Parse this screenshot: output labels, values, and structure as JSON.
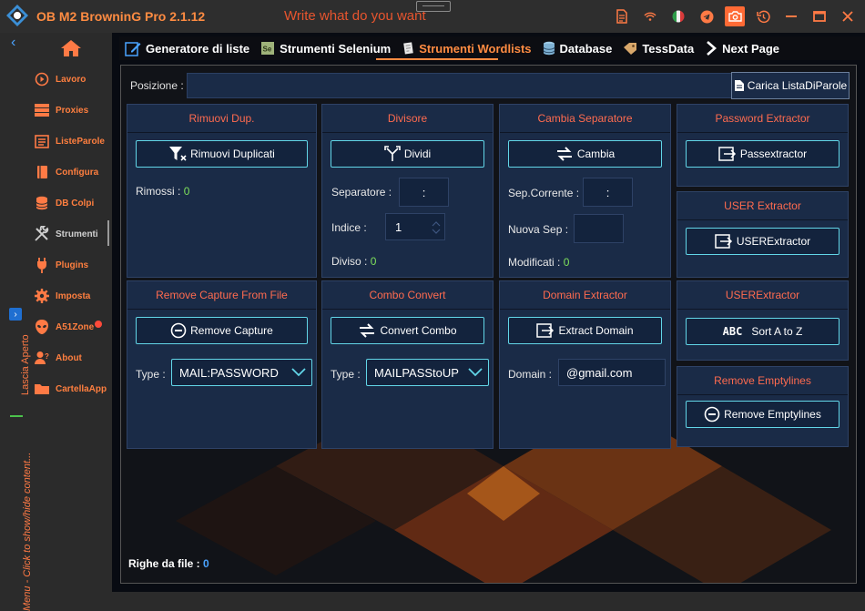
{
  "titlebar": {
    "title": "OB M2 BrowninG Pro  2.1.12",
    "tagline": "Write what do you want",
    "icons": [
      "document-icon",
      "wifi-icon",
      "italy-flag-icon",
      "telegram-icon",
      "camera-icon",
      "history-icon",
      "minimize-icon",
      "maximize-icon",
      "close-icon"
    ]
  },
  "sidebar": {
    "items": [
      {
        "label": "Lavoro",
        "icon": "play-icon"
      },
      {
        "label": "Proxies",
        "icon": "server-icon"
      },
      {
        "label": "ListeParole",
        "icon": "list-icon"
      },
      {
        "label": "Configura",
        "icon": "book-icon"
      },
      {
        "label": "DB Colpi",
        "icon": "database-icon"
      },
      {
        "label": "Strumenti",
        "icon": "tools-icon"
      },
      {
        "label": "Plugins",
        "icon": "plug-icon"
      },
      {
        "label": "Imposta",
        "icon": "gear-icon"
      },
      {
        "label": "A51Zone",
        "icon": "alien-icon"
      },
      {
        "label": "About",
        "icon": "user-question-icon"
      },
      {
        "label": "CartellaApp",
        "icon": "folder-icon"
      }
    ],
    "vertical_open": "Lascia Aperto",
    "vertical_menu": "Menu - Click to show/hide content..."
  },
  "tabs": [
    {
      "label": "Generatore di liste",
      "icon": "edit-icon"
    },
    {
      "label": "Strumenti Selenium",
      "icon": "selenium-icon"
    },
    {
      "label": "Strumenti Wordlists",
      "icon": "scroll-icon"
    },
    {
      "label": "Database",
      "icon": "database-icon"
    },
    {
      "label": "TessData",
      "icon": "tag-icon"
    },
    {
      "label": "Next Page",
      "icon": "chevron-right-icon"
    }
  ],
  "posizione": {
    "label": "Posizione :",
    "value": "",
    "button": "Carica ListaDiParole"
  },
  "rimuovi": {
    "title": "Rimuovi Dup.",
    "button": "Rimuovi Duplicati",
    "rimossi_label": "Rimossi :",
    "rimossi_value": "0"
  },
  "divisore": {
    "title": "Divisore",
    "button": "Dividi",
    "separatore_label": "Separatore :",
    "separatore_value": ":",
    "indice_label": "Indice :",
    "indice_value": "1",
    "diviso_label": "Diviso :",
    "diviso_value": "0"
  },
  "cambia": {
    "title": "Cambia Separatore",
    "button": "Cambia",
    "sep_label": "Sep.Corrente :",
    "sep_value": ":",
    "nuova_label": "Nuova Sep :",
    "nuova_value": "",
    "mod_label": "Modificati :",
    "mod_value": "0"
  },
  "password_extractor": {
    "title": "Password Extractor",
    "button": "Passextractor"
  },
  "user_extractor": {
    "title": "USER Extractor",
    "button": "USERExtractor"
  },
  "remove_capture": {
    "title": "Remove Capture From File",
    "button": "Remove Capture",
    "type_label": "Type :",
    "type_value": "MAIL:PASSWORD"
  },
  "combo_convert": {
    "title": "Combo Convert",
    "button": "Convert Combo",
    "type_label": "Type :",
    "type_value": "MAILPASStoUP"
  },
  "domain_extractor": {
    "title": "Domain Extractor",
    "button": "Extract Domain",
    "domain_label": "Domain :",
    "domain_value": "@gmail.com"
  },
  "userextractor2": {
    "title": "USERExtractor",
    "button_abc": "ABC",
    "button": "Sort A to Z"
  },
  "remove_empty": {
    "title": "Remove Emptylines",
    "button": "Remove Emptylines"
  },
  "footer": {
    "righe_label": "Righe da file :",
    "righe_value": "0"
  },
  "colors": {
    "accent": "#ff8c42",
    "card_bg": "#1a2b47",
    "button_border": "#62d6e8",
    "value_green": "#7ee05b",
    "card_title": "#ff6b4f"
  }
}
